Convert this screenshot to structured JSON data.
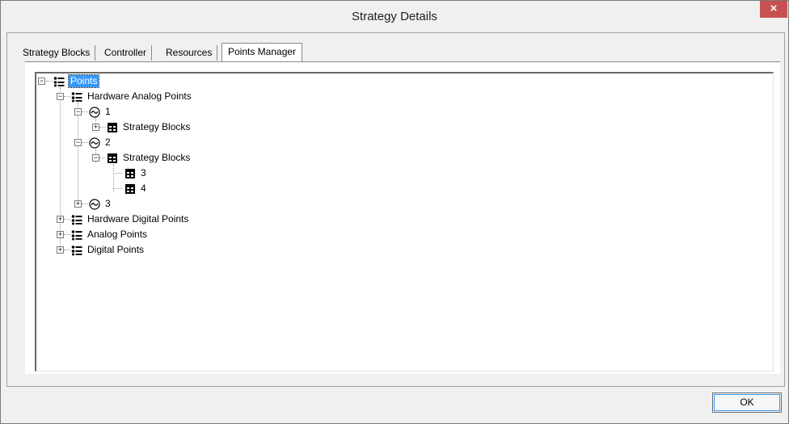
{
  "window": {
    "title": "Strategy Details",
    "close_glyph": "×"
  },
  "tabs": [
    {
      "label": "Strategy Blocks",
      "active": false
    },
    {
      "label": "Controller",
      "active": false
    },
    {
      "label": "Resources",
      "active": false
    },
    {
      "label": "Points Manager",
      "active": true
    }
  ],
  "tree": {
    "root": {
      "label": "Points",
      "expanded": true,
      "selected": true,
      "icon": "list-icon"
    },
    "hardware_analog": {
      "label": "Hardware Analog Points",
      "expanded": true,
      "icon": "list-icon"
    },
    "point_1": {
      "label": "1",
      "expanded": true,
      "icon": "analog-wave-icon"
    },
    "point_1_blocks": {
      "label": "Strategy Blocks",
      "expanded": false,
      "icon": "block-icon"
    },
    "point_2": {
      "label": "2",
      "expanded": true,
      "icon": "analog-wave-icon"
    },
    "point_2_blocks": {
      "label": "Strategy Blocks",
      "expanded": true,
      "icon": "block-icon"
    },
    "block_3": {
      "label": "3",
      "icon": "block-icon"
    },
    "block_4": {
      "label": "4",
      "icon": "block-icon"
    },
    "point_3": {
      "label": "3",
      "expanded": false,
      "icon": "analog-wave-icon"
    },
    "hardware_digital": {
      "label": "Hardware Digital Points",
      "expanded": false,
      "icon": "list-icon"
    },
    "analog": {
      "label": "Analog Points",
      "expanded": false,
      "icon": "list-icon"
    },
    "digital": {
      "label": "Digital Points",
      "expanded": false,
      "icon": "list-icon"
    }
  },
  "buttons": {
    "ok_label": "OK"
  },
  "colors": {
    "selection": "#3399ff",
    "close_button": "#c75050"
  }
}
